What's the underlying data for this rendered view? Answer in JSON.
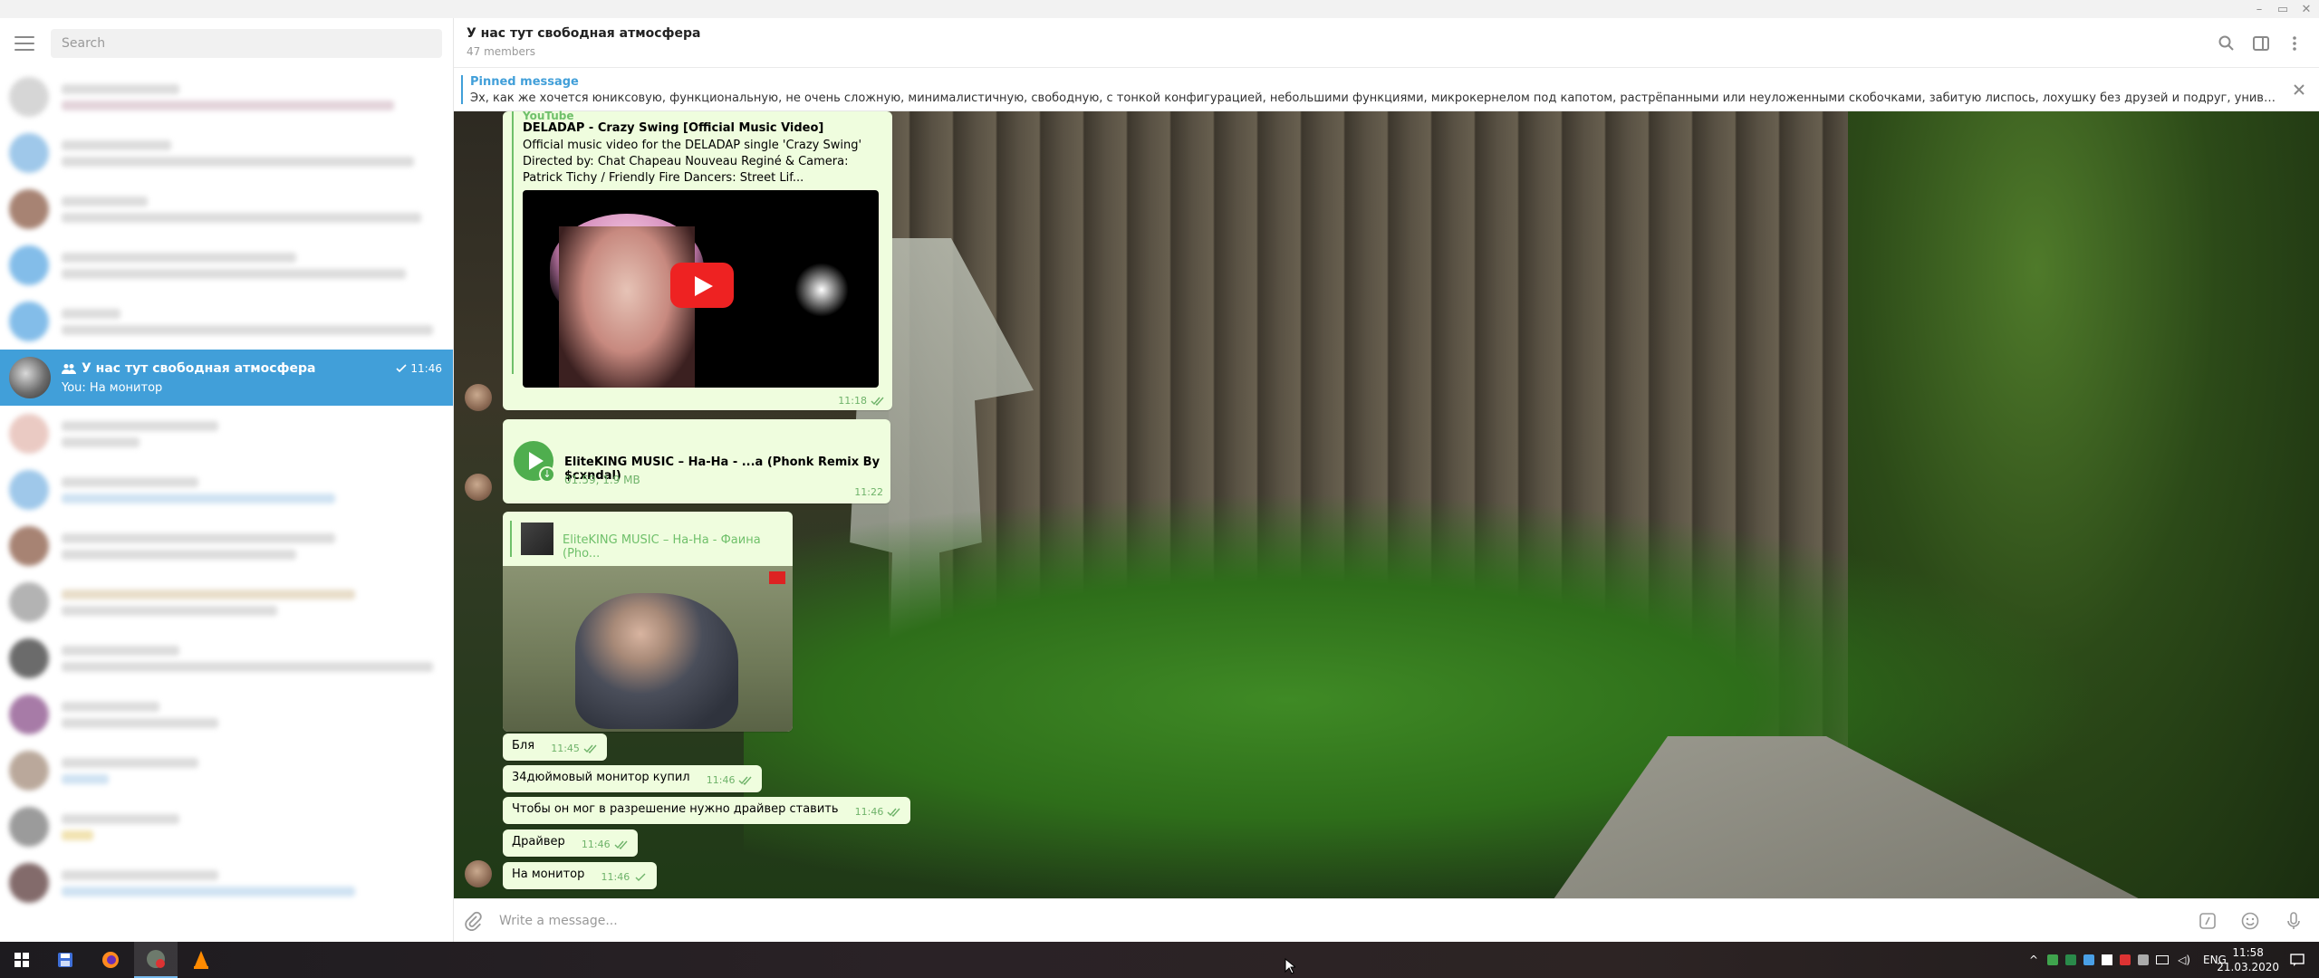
{
  "window": {
    "minimize": "–",
    "maximize": "▭",
    "close": "✕"
  },
  "left_panel": {
    "search_placeholder": "Search",
    "active_chat": {
      "title": "У нас тут свободная атмосфера",
      "time": "11:46",
      "preview": "You: На монитор"
    }
  },
  "chat": {
    "title": "У нас тут свободная атмосфера",
    "subtitle": "47 members"
  },
  "pinned": {
    "label": "Pinned message",
    "text": "Эх, как же хочется юниксовую, функциональную, не очень сложную, минималистичную, свободную, с тонкой конфигурацией, небольшими функциями, микрокернелом под капотом, растрёпанными или неуложенными скобочками, забитую лиспось, лохушку без друзей и подруг, универсальную, открытую ооп..."
  },
  "messages": {
    "link": {
      "site": "YouTube",
      "title": "DELADAP - Crazy Swing [Official Music Video]",
      "desc": "Official music video for the DELADAP single 'Crazy Swing' Directed by: Chat Chapeau Nouveau Reginé & Camera: Patrick Tichy / Friendly Fire Dancers: Street Lif...",
      "time": "11:18"
    },
    "audio": {
      "title": "EliteKING MUSIC – Ha-Ha - ...a (Phonk Remix By $cxndal)",
      "meta": "01:59, 1.9 MB",
      "time": "11:22"
    },
    "media": {
      "caption": "EliteKING MUSIC – На-На - Фаина (Pho..."
    },
    "texts": [
      {
        "text": "Бля",
        "time": "11:45"
      },
      {
        "text": "34дюймовый монитор купил",
        "time": "11:46"
      },
      {
        "text": "Чтобы он мог в разрешение нужно драйвер ставить",
        "time": "11:46"
      },
      {
        "text": "Драйвер",
        "time": "11:46"
      },
      {
        "text": "На монитор",
        "time": "11:46"
      }
    ]
  },
  "composer": {
    "placeholder": "Write a message..."
  },
  "taskbar": {
    "lang": "ENG",
    "time": "11:58",
    "date": "21.03.2020"
  },
  "colors": {
    "accent": "#419fd9",
    "bubble": "#effdde",
    "check": "#6fb36a"
  }
}
